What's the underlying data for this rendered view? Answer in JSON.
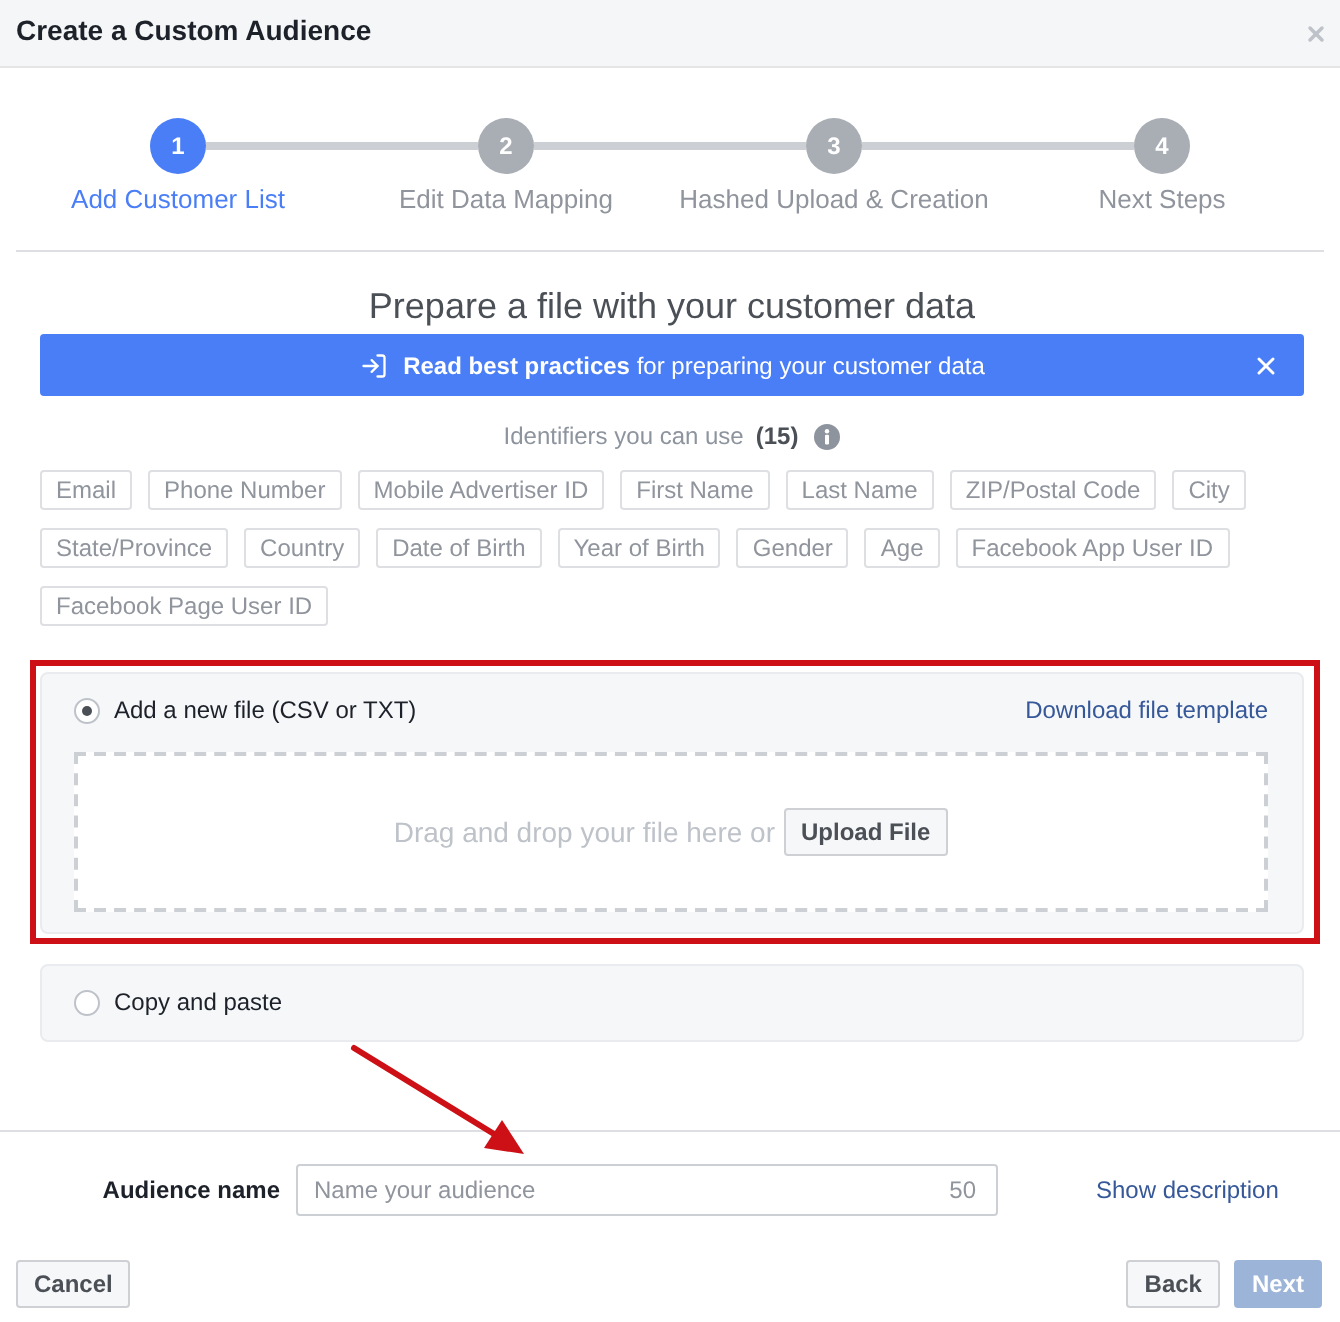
{
  "window": {
    "title": "Create a Custom Audience"
  },
  "steps": [
    {
      "number": "1",
      "label": "Add Customer List",
      "selected": true
    },
    {
      "number": "2",
      "label": "Edit Data Mapping",
      "selected": false
    },
    {
      "number": "3",
      "label": "Hashed Upload & Creation",
      "selected": false
    },
    {
      "number": "4",
      "label": "Next Steps",
      "selected": false
    }
  ],
  "heading": "Prepare a file with your customer data",
  "banner": {
    "text": "**Read best practices** for preparing your customer data"
  },
  "identifiers": {
    "label": "Identifiers you can use",
    "count": "(15)",
    "tags": [
      "Email",
      "Phone Number",
      "Mobile Advertiser ID",
      "First Name",
      "Last Name",
      "ZIP/Postal Code",
      "City",
      "State/Province",
      "Country",
      "Date of Birth",
      "Year of Birth",
      "Gender",
      "Age",
      "Facebook App User ID",
      "Facebook Page User ID"
    ]
  },
  "options": [
    {
      "kind": "upload",
      "label": "Add a new file (CSV or TXT)",
      "selected": true,
      "highlighted": true,
      "link": "Download file template",
      "drop_text": "Drag and drop your file here or",
      "button": "Upload File"
    },
    {
      "kind": "paste",
      "label": "Copy and paste",
      "selected": false,
      "highlighted": false
    }
  ],
  "annotation_arrow": true,
  "audience_name": {
    "label": "Audience name",
    "placeholder": "Name your audience",
    "counter": "50",
    "link": "Show description"
  },
  "footer": {
    "buttons_left": [
      {
        "label": "Cancel",
        "kind": "secondary",
        "disabled": false
      }
    ],
    "buttons_right": [
      {
        "label": "Back",
        "kind": "secondary",
        "disabled": false
      },
      {
        "label": "Next",
        "kind": "primary",
        "disabled": true
      }
    ]
  }
}
